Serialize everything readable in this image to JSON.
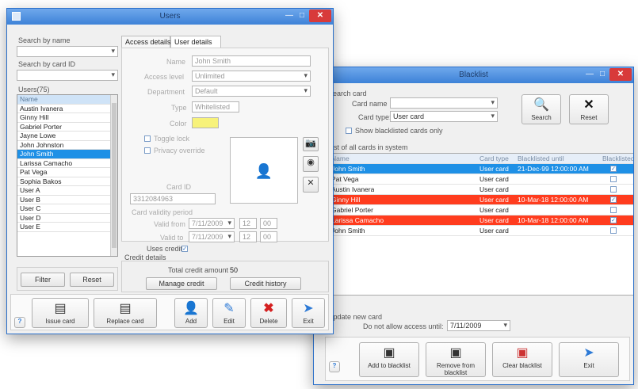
{
  "colors": {
    "titlebar": "#4a8fe0",
    "selection": "#1e90e6",
    "blacklisted": "#ff3c1e",
    "close": "#d83a3a",
    "card_color": "#f7f27a"
  },
  "users_window": {
    "title": "Users",
    "search_by_name_label": "Search by name",
    "search_by_card_label": "Search by card ID",
    "users_label": "Users(75)",
    "users_list": [
      "Name",
      "Austin Ivanera",
      "Ginny Hill",
      "Gabriel Porter",
      "Jayne Lowe",
      "John Johnston",
      "John Smith",
      "Larissa Camacho",
      "Pat Vega",
      "Sophia Bakos",
      "User A",
      "User B",
      "User C",
      "User D",
      "User E"
    ],
    "selected_user_index": 6,
    "filter_button": "Filter",
    "reset_button": "Reset",
    "tabs": [
      "Access details",
      "User details"
    ],
    "form": {
      "name_label": "Name",
      "name_value": "John Smith",
      "access_level_label": "Access level",
      "access_level_value": "Unlimited",
      "department_label": "Department",
      "department_value": "Default",
      "type_label": "Type",
      "type_value": "Whitelisted",
      "color_label": "Color",
      "toggle_label": "Toggle lock",
      "privacy_label": "Privacy override",
      "card_id_label": "Card ID",
      "card_id_value": "3312084963",
      "validity_label": "Card validity period",
      "valid_from_label": "Valid from",
      "valid_from_date": "7/11/2009",
      "valid_from_h": "12",
      "valid_from_m": "00",
      "valid_to_label": "Valid to",
      "valid_to_date": "7/11/2009",
      "valid_to_h": "12",
      "valid_to_m": "00"
    },
    "uses_credit_label": "Uses credit",
    "credit_details_label": "Credit details",
    "total_credit_label": "Total credit amount",
    "total_credit_value": "50",
    "manage_credit_button": "Manage credit",
    "credit_history_button": "Credit history",
    "toolbar": [
      "Issue card",
      "Replace card",
      "Add",
      "Edit",
      "Delete",
      "Exit"
    ],
    "help_label": "?"
  },
  "blacklist_window": {
    "title": "Blacklist",
    "search_label": "Search card",
    "card_name_label": "Card name",
    "card_type_label": "Card type:",
    "card_type_value": "User card",
    "show_blacklisted_label": "Show blacklisted cards only",
    "search_button": "Search",
    "reset_button": "Reset",
    "list_label": "List of all cards in system",
    "columns": [
      "Name",
      "Card type",
      "Blacklisted until",
      "Blacklisted"
    ],
    "rows": [
      {
        "name": "John Smith",
        "type": "User card",
        "until": "21-Dec-99 12:00:00 AM",
        "checked": true,
        "highlight": "selected"
      },
      {
        "name": "Pat Vega",
        "type": "User card",
        "until": "",
        "checked": false,
        "highlight": ""
      },
      {
        "name": "Austin Ivanera",
        "type": "User card",
        "until": "",
        "checked": false,
        "highlight": ""
      },
      {
        "name": "Ginny Hill",
        "type": "User card",
        "until": "10-Mar-18 12:00:00 AM",
        "checked": true,
        "highlight": "red"
      },
      {
        "name": "Gabriel Porter",
        "type": "User card",
        "until": "",
        "checked": false,
        "highlight": ""
      },
      {
        "name": "Larissa Camacho",
        "type": "User card",
        "until": "10-Mar-18 12:00:00 AM",
        "checked": true,
        "highlight": "red"
      },
      {
        "name": "John Smith",
        "type": "User card",
        "until": "",
        "checked": false,
        "highlight": ""
      }
    ],
    "update_label": "Update new card",
    "do_not_allow_label": "Do not allow access until:",
    "do_not_allow_value": "7/11/2009",
    "toolbar": [
      "Add to blacklist",
      "Remove from blacklist",
      "Clear blacklist",
      "Exit"
    ],
    "help_label": "?"
  }
}
